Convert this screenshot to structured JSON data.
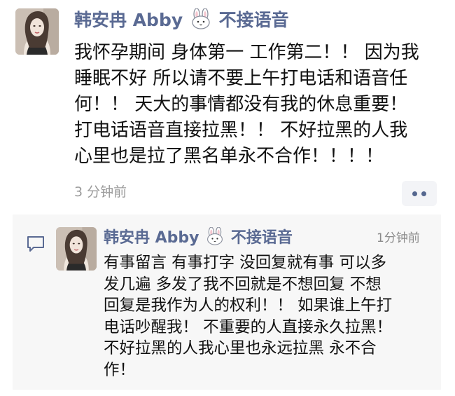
{
  "post": {
    "author_name": "韩安冉 Abby",
    "author_suffix": "不接语音",
    "text_lines": [
      "我怀孕期间 身体第一 工作第二！！ 因为我",
      "睡眠不好 所以请不要上午打电话和语音任",
      "何！！ 天大的事情都没有我的休息重要！",
      "打电话语音直接拉黑！！ 不好拉黑的人我",
      "心里也是拉了黑名单永不合作！！！！"
    ],
    "time": "3 分钟前"
  },
  "comment": {
    "author_name": "韩安冉 Abby",
    "author_suffix": "不接语音",
    "time": "1分钟前",
    "text_lines": [
      "有事留言 有事打字  没回复就有事  可以多",
      "发几遍  多发了我不回就是不想回复  不想",
      "回复是我作为人的权利！！ 如果谁上午打",
      "电话吵醒我！ 不重要的人直接永久拉黑！",
      "不好拉黑的人我心里也永远拉黑  永不合",
      "作！"
    ]
  },
  "icons": {
    "emoji": "rabbit-face-icon",
    "comment": "comment-bubble-icon",
    "more": "more-dots-icon"
  },
  "colors": {
    "name": "#5a6a93",
    "text": "#111111",
    "time": "#9b9b9b",
    "comment_background": "#f7f7f7"
  }
}
